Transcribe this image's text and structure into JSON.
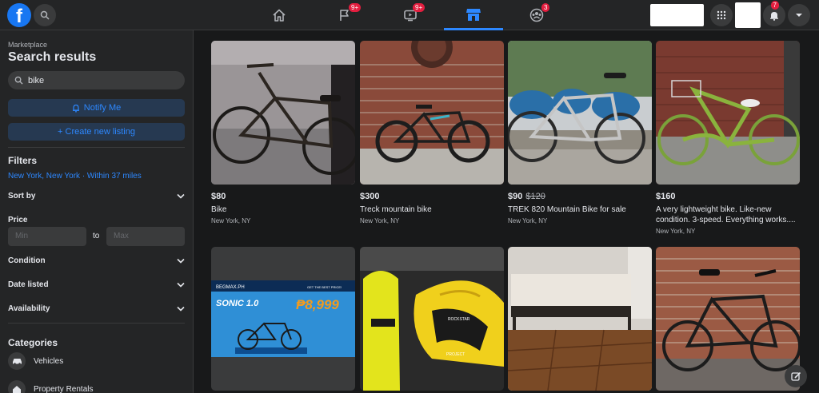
{
  "topbar": {
    "logo_letter": "f",
    "badges": {
      "pages": "9+",
      "watch": "9+",
      "groups": "3",
      "notifications": "7"
    }
  },
  "sidebar": {
    "section_label": "Marketplace",
    "title": "Search results",
    "search": {
      "value": "bike"
    },
    "notify_label": "Notify Me",
    "create_label": "+ Create new listing",
    "filters_heading": "Filters",
    "location": "New York, New York · Within 37 miles",
    "sort_label": "Sort by",
    "price_label": "Price",
    "price_min_placeholder": "Min",
    "price_to": "to",
    "price_max_placeholder": "Max",
    "condition_label": "Condition",
    "date_label": "Date listed",
    "availability_label": "Availability",
    "categories_heading": "Categories",
    "categories": [
      "Vehicles",
      "Property Rentals"
    ]
  },
  "listings": [
    {
      "price": "$80",
      "old_price": "",
      "title": "Bike",
      "location": "New York, NY"
    },
    {
      "price": "$300",
      "old_price": "",
      "title": "Treck mountain bike",
      "location": "New York, NY"
    },
    {
      "price": "$90",
      "old_price": "$120",
      "title": "TREK 820 Mountain Bike for sale",
      "location": "New York, NY"
    },
    {
      "price": "$160",
      "old_price": "",
      "title": "A very lightweight bike. Like-new condition. 3-speed. Everything works....",
      "location": "New York, NY"
    }
  ],
  "ad": {
    "brand": "BEGMAX.PH",
    "model": "SONIC 1.0",
    "price": "₱8,999",
    "tagline": "GET THE BEST PRICE!"
  },
  "helmet_text": [
    "ROCKSTAR",
    "PROJECT"
  ],
  "colors": {
    "accent": "#2d88ff",
    "badge": "#e41e3f",
    "bg": "#18191a",
    "panel": "#242526"
  },
  "icons": [
    "search-icon",
    "home-icon",
    "flag-icon",
    "watch-icon",
    "marketplace-icon",
    "groups-icon",
    "menu-grid-icon",
    "bell-icon",
    "caret-down-icon",
    "bell-outline-icon",
    "chevron-down-icon",
    "car-icon",
    "house-icon",
    "compose-icon"
  ]
}
